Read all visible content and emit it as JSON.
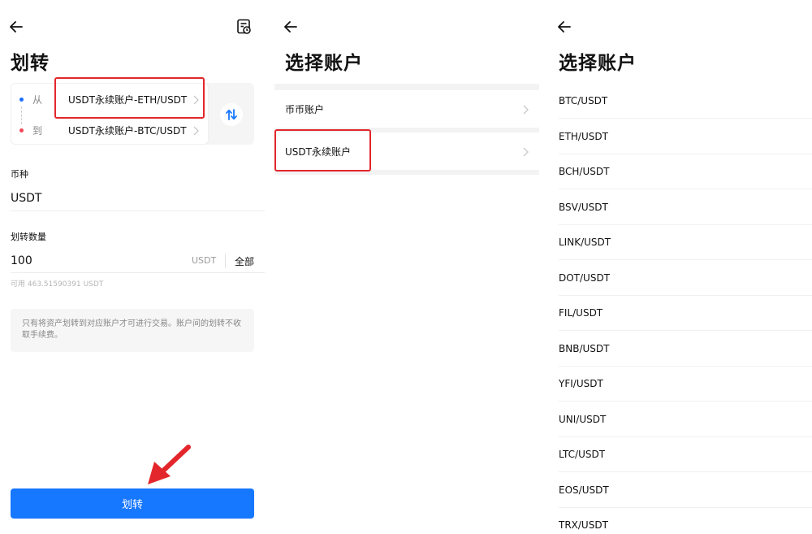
{
  "transfer_screen": {
    "title": "划转",
    "from_label": "从",
    "from_account": "USDT永续账户-ETH/USDT",
    "to_label": "到",
    "to_account": "USDT永续账户-BTC/USDT",
    "currency_label": "币种",
    "currency_value": "USDT",
    "amount_label": "划转数量",
    "amount_value": "100",
    "amount_unit": "USDT",
    "all_button": "全部",
    "available": "可用 463.51590391 USDT",
    "notice": "只有将资产划转到对应账户才可进行交易。账户间的划转不收取手续费。",
    "submit_label": "划转"
  },
  "select_account_screen": {
    "title": "选择账户",
    "accounts": [
      "币币账户",
      "USDT永续账户"
    ]
  },
  "select_pair_screen": {
    "title": "选择账户",
    "pairs": [
      "BTC/USDT",
      "ETH/USDT",
      "BCH/USDT",
      "BSV/USDT",
      "LINK/USDT",
      "DOT/USDT",
      "FIL/USDT",
      "BNB/USDT",
      "YFI/USDT",
      "UNI/USDT",
      "LTC/USDT",
      "EOS/USDT",
      "TRX/USDT"
    ]
  },
  "colors": {
    "accent": "#1677ff",
    "highlight": "#e3262b",
    "from_dot": "#1a6dff",
    "to_dot": "#f5485b"
  },
  "icons": {
    "back": "arrow-left-icon",
    "record": "transfer-record-icon",
    "swap": "swap-arrows-icon",
    "chevron": "chevron-right-icon"
  }
}
